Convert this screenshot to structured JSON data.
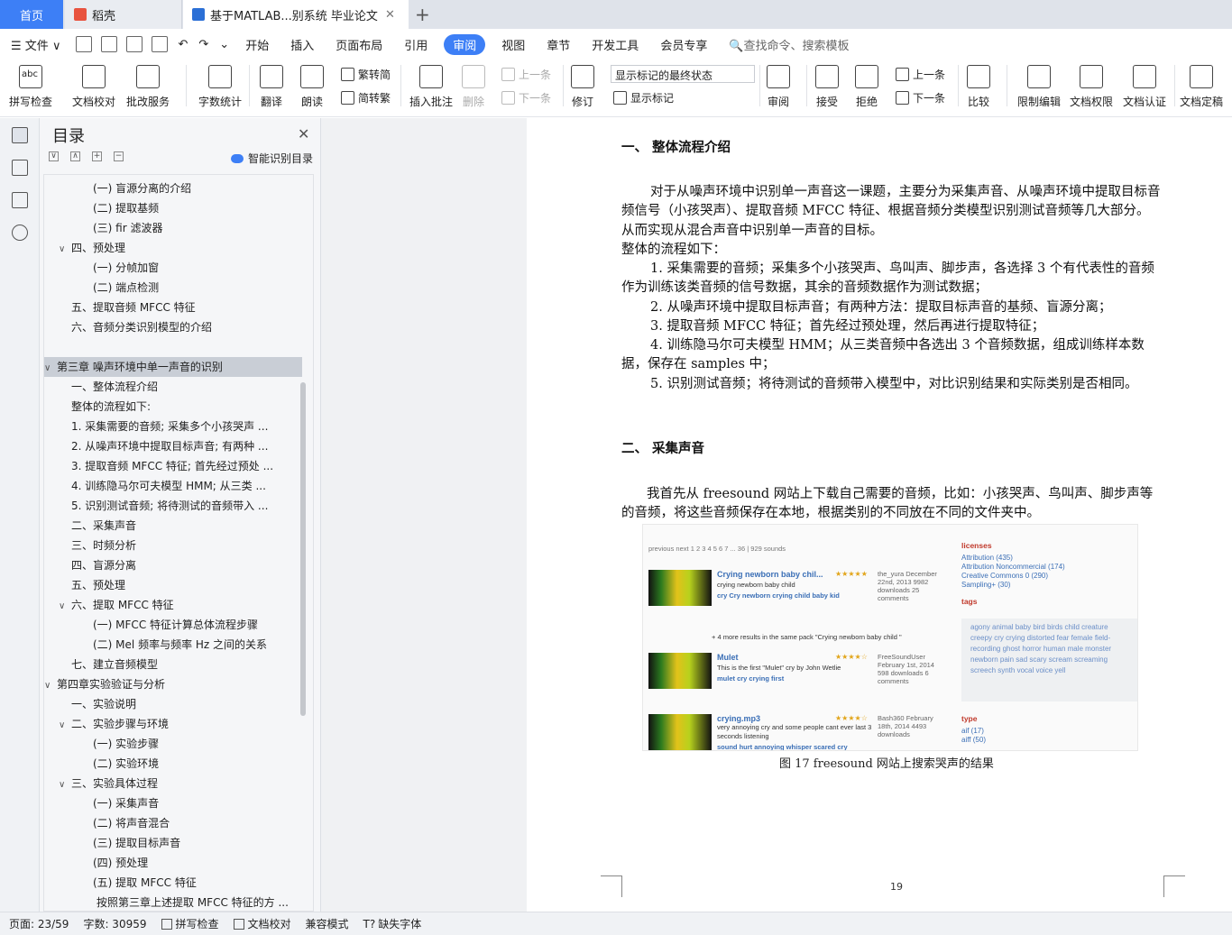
{
  "tabs": {
    "home": "首页",
    "shell": "稻壳",
    "doc": "基于MATLAB...别系统 毕业论文",
    "plus": "+"
  },
  "menu": {
    "file": "文件",
    "items": [
      "开始",
      "插入",
      "页面布局",
      "引用",
      "审阅",
      "视图",
      "章节",
      "开发工具",
      "会员专享"
    ],
    "active": "审阅",
    "search": "查找命令、搜索模板"
  },
  "ribbon": {
    "spell": "拼写检查",
    "abc": "abc",
    "proof": "文档校对",
    "batch": "批改服务",
    "wordcount": "字数统计",
    "translate": "翻译",
    "read": "朗读",
    "trad": "繁转简",
    "simp": "简转繁",
    "insert_comment": "插入批注",
    "delete": "删除",
    "prev_c": "上一条",
    "next_c": "下一条",
    "revise": "修订",
    "show_mode": "显示标记的最终状态",
    "show_marks": "显示标记",
    "review": "审阅",
    "accept": "接受",
    "reject": "拒绝",
    "prev": "上一条",
    "next": "下一条",
    "compare": "比较",
    "restrict": "限制编辑",
    "perm": "文档权限",
    "auth": "文档认证",
    "finalize": "文档定稿"
  },
  "toc": {
    "title": "目录",
    "smart": "智能识别目录",
    "items": [
      {
        "text": "(一) 盲源分离的介绍",
        "level": 3
      },
      {
        "text": "(二) 提取基频",
        "level": 3
      },
      {
        "text": "(三) fir 滤波器",
        "level": 3
      },
      {
        "text": "四、预处理",
        "level": 2,
        "car": "∨"
      },
      {
        "text": "(一) 分帧加窗",
        "level": 3
      },
      {
        "text": "(二) 端点检测",
        "level": 3
      },
      {
        "text": "五、提取音频 MFCC 特征",
        "level": 2
      },
      {
        "text": "六、音频分类识别模型的介绍",
        "level": 2
      },
      {
        "text": "",
        "level": 2
      },
      {
        "text": "第三章 噪声环境中单一声音的识别",
        "level": 1,
        "car": "∨",
        "sel": true
      },
      {
        "text": "一、整体流程介绍",
        "level": 2
      },
      {
        "text": "整体的流程如下:",
        "level": 2
      },
      {
        "text": "1. 采集需要的音频; 采集多个小孩哭声 ...",
        "level": 2
      },
      {
        "text": "2. 从噪声环境中提取目标声音; 有两种 ...",
        "level": 2
      },
      {
        "text": "3. 提取音频 MFCC 特征; 首先经过预处 ...",
        "level": 2
      },
      {
        "text": "4. 训练隐马尔可夫模型 HMM; 从三类 ...",
        "level": 2
      },
      {
        "text": "5. 识别测试音频; 将待测试的音频带入 ...",
        "level": 2
      },
      {
        "text": "二、采集声音",
        "level": 2
      },
      {
        "text": "三、时频分析",
        "level": 2
      },
      {
        "text": "四、盲源分离",
        "level": 2
      },
      {
        "text": "五、预处理",
        "level": 2
      },
      {
        "text": "六、提取 MFCC 特征",
        "level": 2,
        "car": "∨"
      },
      {
        "text": "(一) MFCC 特征计算总体流程步骤",
        "level": 3
      },
      {
        "text": "(二) Mel 频率与频率 Hz 之间的关系",
        "level": 3
      },
      {
        "text": "七、建立音频模型",
        "level": 2
      },
      {
        "text": "第四章实验验证与分析",
        "level": 1,
        "car": "∨"
      },
      {
        "text": "一、实验说明",
        "level": 2
      },
      {
        "text": "二、实验步骤与环境",
        "level": 2,
        "car": "∨"
      },
      {
        "text": "(一) 实验步骤",
        "level": 3
      },
      {
        "text": "(二) 实验环境",
        "level": 3
      },
      {
        "text": "三、实验具体过程",
        "level": 2,
        "car": "∨"
      },
      {
        "text": "(一) 采集声音",
        "level": 3
      },
      {
        "text": "(二) 将声音混合",
        "level": 3
      },
      {
        "text": "(三) 提取目标声音",
        "level": 3
      },
      {
        "text": "(四) 预处理",
        "level": 3
      },
      {
        "text": "(五) 提取 MFCC 特征",
        "level": 3
      },
      {
        "text": "按照第三章上述提取 MFCC 特征的方 ...",
        "level": 4
      }
    ]
  },
  "doc": {
    "h1": "一、 整体流程介绍",
    "p1": "对于从噪声环境中识别单一声音这一课题，主要分为采集声音、从噪声环境中提取目标音频信号（小孩哭声）、提取音频 MFCC 特征、根据音频分类模型识别测试音频等几大部分。从而实现从混合声音中识别单一声音的目标。",
    "p2": "整体的流程如下：",
    "l1": "1. 采集需要的音频；采集多个小孩哭声、鸟叫声、脚步声，各选择 3 个有代表性的音频作为训练该类音频的信号数据，其余的音频数据作为测试数据；",
    "l2": "2. 从噪声环境中提取目标声音；有两种方法：提取目标声音的基频、盲源分离；",
    "l3": "3. 提取音频 MFCC 特征；首先经过预处理，然后再进行提取特征；",
    "l4": "4. 训练隐马尔可夫模型 HMM；从三类音频中各选出 3 个音频数据，组成训练样本数据，保存在 samples 中；",
    "l5": "5. 识别测试音频；将待测试的音频带入模型中，对比识别结果和实际类别是否相同。",
    "h2": "二、 采集声音",
    "p3": "我首先从 freesound 网站上下载自己需要的音频，比如：小孩哭声、鸟叫声、脚步声等的音频，将这些音频保存在本地，根据类别的不同放在不同的文件夹中。",
    "caption": "图 17 freesound 网站上搜索哭声的结果",
    "page": "19"
  },
  "shot": {
    "pager": "previous   next  1 2 3 4 5 6 7 ... 36 | 929 sounds",
    "r1_title": "Crying newborn baby chil...",
    "r1_sub": "crying newborn baby child",
    "r1_tags": "cry Cry newborn crying child baby kid",
    "r1_meta": "the_yura December 22nd, 2013 9982 downloads 25 comments",
    "r1_more": "+ 4 more results in the same pack \"Crying newborn baby child \"",
    "r2_title": "Mulet",
    "r2_sub": "This is the first \"Mulet\" cry by John Wetlie",
    "r2_tags": "mulet cry crying first",
    "r2_meta": "FreeSoundUser February 1st, 2014 598 downloads 6 comments",
    "r3_title": "crying.mp3",
    "r3_sub": "very annoying cry and some people cant ever last 3 seconds listening",
    "r3_tags": "sound hurt annoying whisper scared cry",
    "r3_meta": "Bash360 February 18th, 2014 4493 downloads",
    "licenses": "licenses",
    "lic": [
      "Attribution (435)",
      "Attribution Noncommercial (174)",
      "Creative Commons 0 (290)",
      "Sampling+ (30)"
    ],
    "tags_h": "tags",
    "tags": "agony animal baby bird birds child creature creepy cry crying distorted fear female field-recording ghost horror human male monster newborn pain sad scary scream screaming screech synth vocal voice yell",
    "type_h": "type",
    "types": [
      "aif (17)",
      "aiff (50)"
    ]
  },
  "status": {
    "page": "页面: 23/59",
    "words": "字数: 30959",
    "spell": "拼写检查",
    "proof": "文档校对",
    "compat": "兼容模式",
    "font": "缺失字体"
  }
}
